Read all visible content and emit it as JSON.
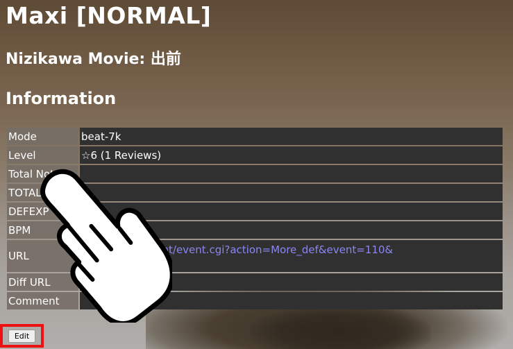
{
  "page": {
    "title": "Maxi [NORMAL]",
    "subtitle": "Nizikawa Movie: 出前",
    "section_heading": "Information"
  },
  "info_rows": [
    {
      "key": "Mode",
      "value": "beat-7k"
    },
    {
      "key": "Level",
      "value": "☆6 (1 Reviews)"
    },
    {
      "key": "Total Notes",
      "value": ""
    },
    {
      "key": "TOTAL",
      "value": ""
    },
    {
      "key": "DEFEXP",
      "value": ""
    },
    {
      "key": "BPM",
      "value": ""
    },
    {
      "key": "URL",
      "value": ".nothing.sh/event/event.cgi?action=More_def&event=110&"
    },
    {
      "key": "Diff URL",
      "value": ""
    },
    {
      "key": "Comment",
      "value": ""
    }
  ],
  "actions": {
    "edit_label": "Edit"
  },
  "overlay": {
    "pointer_icon": "pointing-hand-icon",
    "highlight_color": "#ee1111"
  }
}
